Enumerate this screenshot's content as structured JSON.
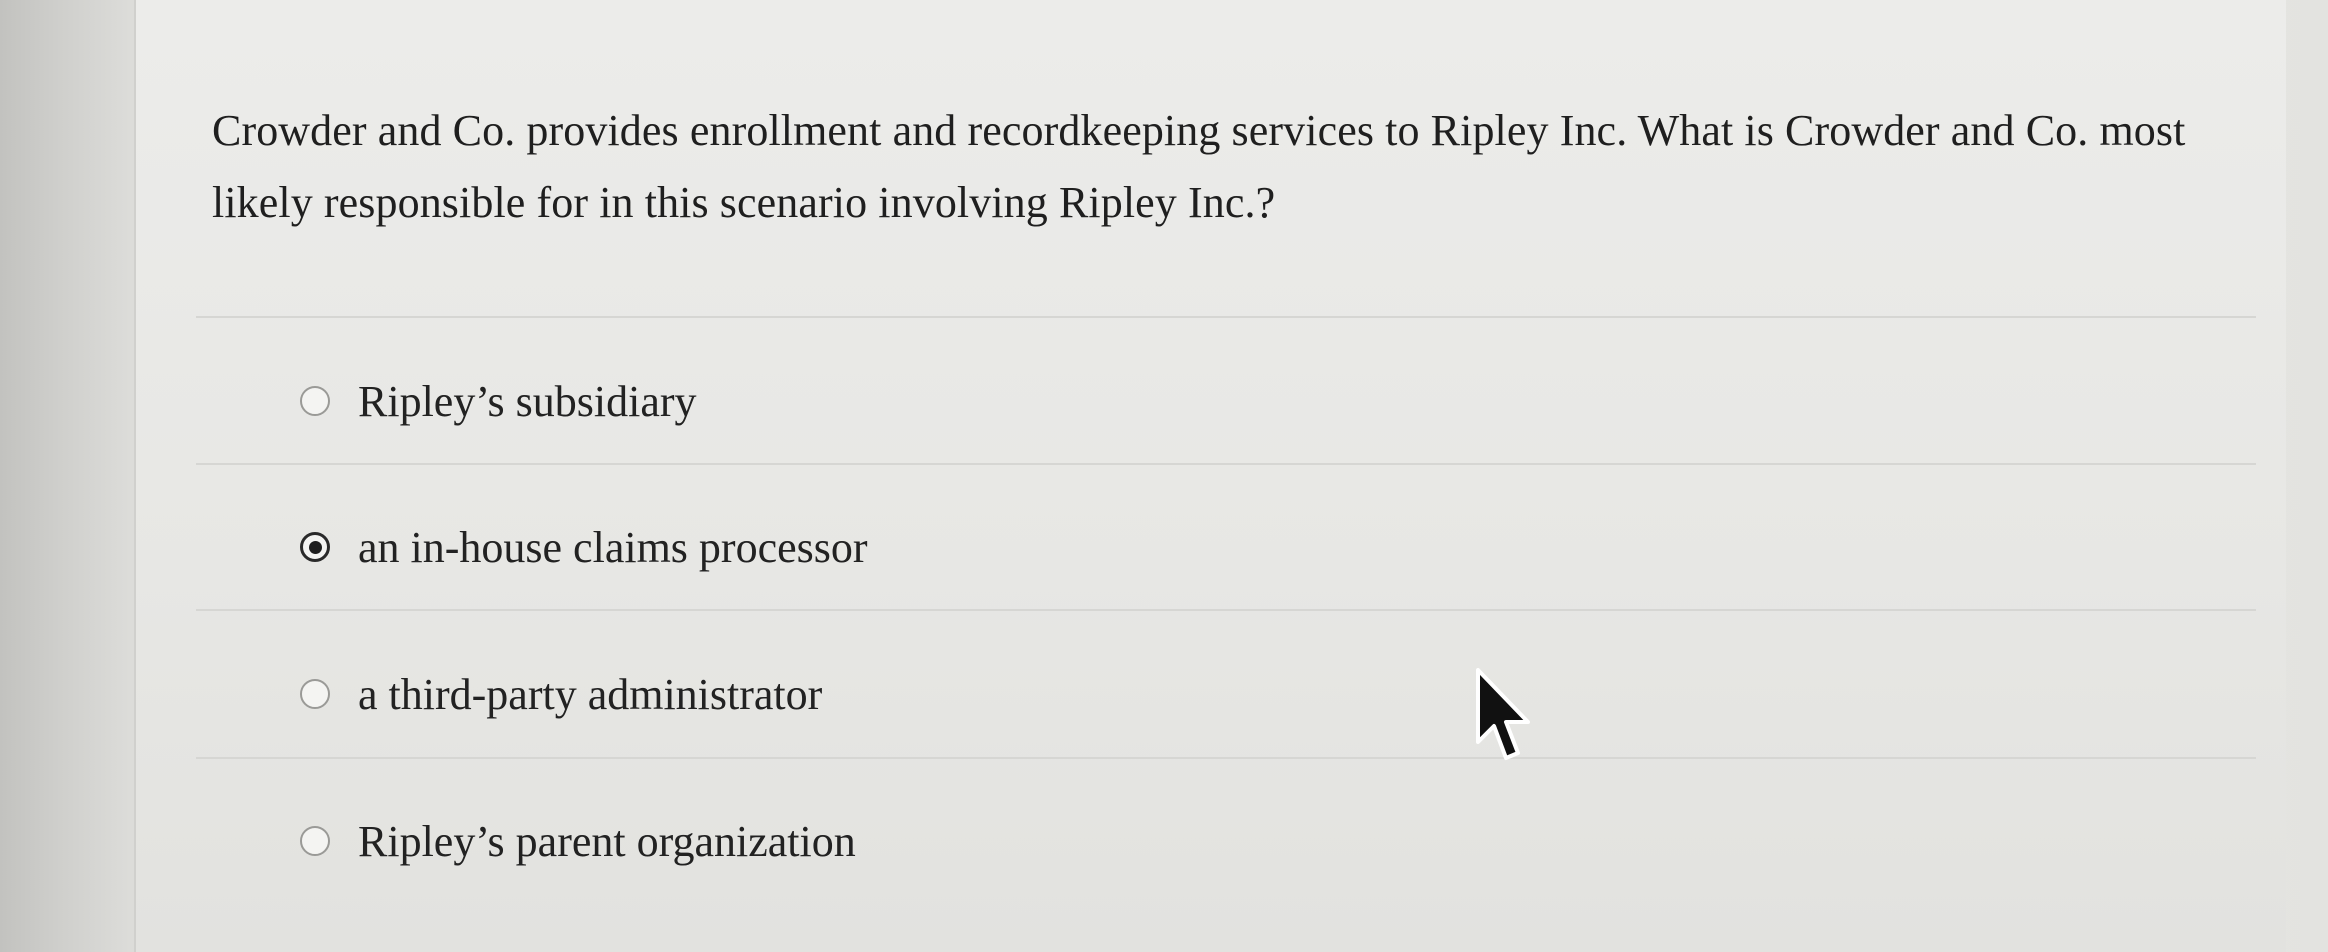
{
  "question": {
    "text": "Crowder and Co. provides enrollment and recordkeeping services to Ripley Inc. What is Crowder and Co. most likely responsible for in this scenario involving Ripley Inc.?"
  },
  "options": [
    {
      "label": "Ripley’s subsidiary",
      "selected": false
    },
    {
      "label": "an in-house claims processor",
      "selected": true
    },
    {
      "label": "a third-party administrator",
      "selected": false
    },
    {
      "label": "Ripley’s parent organization",
      "selected": false
    }
  ],
  "cursor": {
    "icon": "arrow-pointer-icon"
  }
}
